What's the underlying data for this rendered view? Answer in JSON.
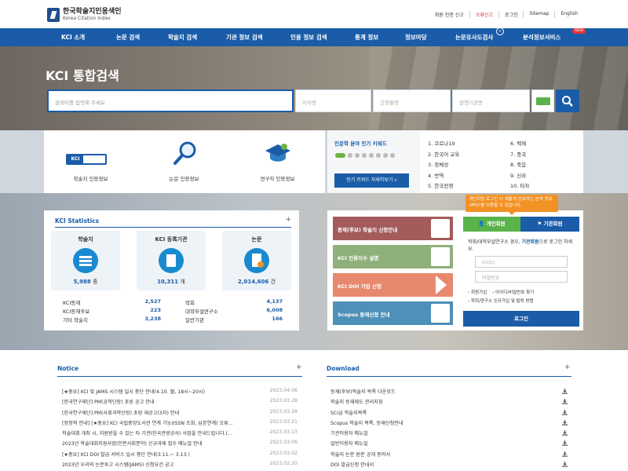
{
  "brand": {
    "name_ko": "한국학술지인용색인",
    "name_en": "Korea Citation Index"
  },
  "util_links": [
    "회원 인증 신고",
    "오류신고",
    "로그인",
    "Sitemap",
    "English"
  ],
  "nav": [
    {
      "label": "KCI 소개"
    },
    {
      "label": "논문 검색"
    },
    {
      "label": "학술지 검색"
    },
    {
      "label": "기관 정보 검색"
    },
    {
      "label": "인용 정보 검색"
    },
    {
      "label": "통계 정보"
    },
    {
      "label": "정보마당"
    },
    {
      "label": "논문유사도검사"
    },
    {
      "label": "분석정보서비스"
    }
  ],
  "new_badge": "NEW",
  "hero": {
    "title": "KCI 통합검색",
    "main_placeholder": "검색어를 입력해 주세요",
    "field1": "저자명",
    "field2": "간행물명",
    "field3": "발행기관명"
  },
  "quick": {
    "item1": "학술지 인용정보",
    "item2": "논문 인용정보",
    "item3": "연구자 인용정보",
    "kci_tag": "KCI"
  },
  "keywords": {
    "title": "인문학 분야 인기 키워드",
    "button": "인기 키워드 자세히보기",
    "left": [
      "1. 코로나19",
      "2. 한국어 교육",
      "3. 정체성",
      "4. 번역",
      "5. 한국전쟁"
    ],
    "right": [
      "6. 백제",
      "7. 중국",
      "8. 죽음",
      "9. 신라",
      "10. 타자"
    ]
  },
  "stats": {
    "title": "KCI Statistics",
    "cards": [
      {
        "title": "학술지",
        "value": "5,988",
        "unit": "종"
      },
      {
        "title": "KCI 등록기관",
        "value": "10,311",
        "unit": "개"
      },
      {
        "title": "논문",
        "value": "2,014,606",
        "unit": "건"
      }
    ],
    "rows": [
      {
        "l1": "KCI등재",
        "v1": "2,527",
        "l2": "학회",
        "v2": "4,137"
      },
      {
        "l1": "KCI등재후보",
        "v1": "223",
        "l2": "대학부설연구소",
        "v2": "6,008"
      },
      {
        "l1": "기타 학술지",
        "v1": "3,238",
        "l2": "일반기관",
        "v2": "166"
      }
    ]
  },
  "tiles": [
    {
      "label": "등재(후보) 학술지 신청안내",
      "color": "#a35b5b"
    },
    {
      "label": "KCI 인용지수 설명",
      "color": "#8fb07a"
    },
    {
      "label": "KCI DOI 가입 신청",
      "color": "#e7896e"
    },
    {
      "label": "Scopus 등재신청 안내",
      "color": "#4e90b8"
    }
  ],
  "login": {
    "tooltip": "개인회원 로그인 시 새롭게 선보이는 분석 정보 서비스를 이용할 수 있습니다.",
    "tab_personal": "개인회원",
    "tab_org": "기관회원",
    "text_a": "학회/대학부설연구소 경우,",
    "text_b": "기관회원",
    "text_c": "으로 로그인 하세요.",
    "id_placeholder": "아이디",
    "pw_placeholder": "비밀번호",
    "link_join": "› 회원가입",
    "link_find": "› 아이디/비밀번호 찾기",
    "link_inst": "› 학회/연구소 신규가입 및 탈퇴 방법",
    "button": "로그인"
  },
  "notice": {
    "title": "Notice",
    "items": [
      {
        "text": "[★중요] KCI 및 JAMS 시스템 일시 중단 안내(4.10. 월, 18시~20시)",
        "date": "2023.04.06"
      },
      {
        "text": "[한국연구재단] PM(공학단장) 초빙 공고 안내",
        "date": "2023.03.28"
      },
      {
        "text": "[한국연구재단] PM(사회과학단장) 초빙 재공고(3차) 안내",
        "date": "2023.03.28"
      },
      {
        "text": "[정정혁 안내] [★중요] KCI 국립중앙도서관 연계 기능(ISSN 조회, 납본연계) 오류...",
        "date": "2023.03.21"
      },
      {
        "text": "학술대회 개최 시, 지원받을 수 있는 타 기관(한국관광공사) 사업을 안내드립니다.(...",
        "date": "2023.03.13"
      },
      {
        "text": "2023년 학술대회지원사업(인문사회분야) 신규과제 접수 매뉴얼 안내",
        "date": "2023.03.06"
      },
      {
        "text": "[★중요] KCI DOI 발급 서비스 일시 중단 안내(3.11.~ 3.13.)",
        "date": "2023.03.02"
      },
      {
        "text": "2023년 우리의 논문투고 시스템(JAMS) 신청요건 공고",
        "date": "2023.02.20"
      }
    ]
  },
  "download": {
    "title": "Download",
    "items": [
      "등재(후보)학술지 목록 다운로드",
      "학술지 등재제도 관리지침",
      "SCI급 학술지목록",
      "Scopus 학술지 목록, 등재신청안내",
      "기관이용자 매뉴얼",
      "일반이용자 매뉴얼",
      "학술지 논문 원문 공개 동의서",
      "DOI 발급신청 안내서"
    ]
  }
}
